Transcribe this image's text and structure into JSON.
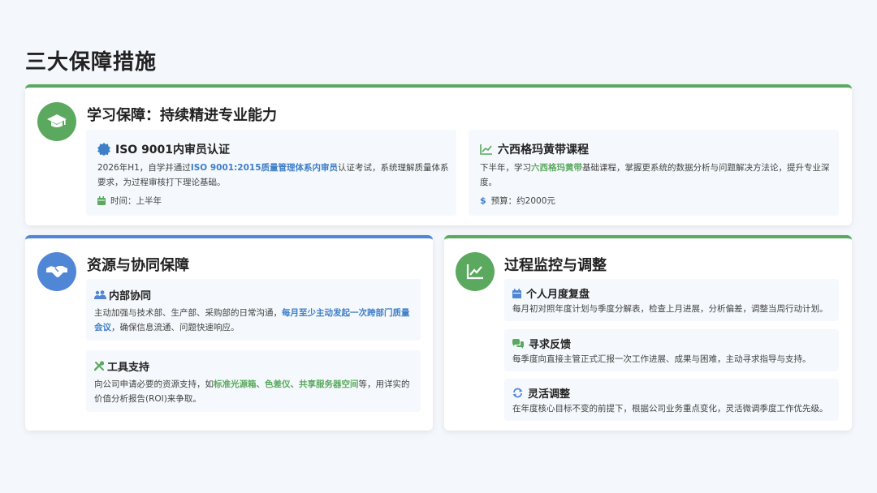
{
  "title": "三大保障措施",
  "colors": {
    "green": "#5aa95e",
    "blue": "#4f86d6",
    "highlight_blue": "#3f7fc8"
  },
  "learning": {
    "icon": "graduation-cap-icon",
    "title": "学习保障：持续精进专业能力",
    "iso": {
      "icon": "badge-icon",
      "title": "ISO 9001内审员认证",
      "text_before": "2026年H1，自学并通过",
      "highlight": "ISO 9001:2015质量管理体系内审员",
      "text_after": "认证考试，系统理解质量体系要求，为过程审核打下理论基础。",
      "meta_icon": "calendar-icon",
      "meta": "时间：上半年"
    },
    "sigma": {
      "icon": "line-chart-icon",
      "title": "六西格玛黄带课程",
      "text_before": "下半年，学习",
      "highlight": "六西格玛黄带",
      "text_after": "基础课程，掌握更系统的数据分析与问题解决方法论，提升专业深度。",
      "meta_icon": "dollar-icon",
      "meta": "预算：约2000元"
    }
  },
  "resource": {
    "icon": "handshake-icon",
    "title": "资源与协同保障",
    "internal": {
      "icon": "users-icon",
      "title": "内部协同",
      "text_before": "主动加强与技术部、生产部、采购部的日常沟通，",
      "highlight": "每月至少主动发起一次跨部门质量会议",
      "text_after": "，确保信息流通、问题快速响应。"
    },
    "tools": {
      "icon": "tools-icon",
      "title": "工具支持",
      "text_1": "向公司申请必要的资源支持，如",
      "hl_1": "标准光源箱",
      "sep_1": "、",
      "hl_2": "色差仪",
      "sep_2": "、",
      "hl_3": "共享服务器空间",
      "text_2": "等，用详实的价值分析报告(ROI)来争取。"
    }
  },
  "monitor": {
    "icon": "chart-icon",
    "title": "过程监控与调整",
    "items": [
      {
        "icon": "calendar-icon",
        "title": "个人月度复盘",
        "text": "每月初对照年度计划与季度分解表，检查上月进展，分析偏差，调整当周行动计划。"
      },
      {
        "icon": "comments-icon",
        "title": "寻求反馈",
        "text": "每季度向直接主管正式汇报一次工作进展、成果与困难，主动寻求指导与支持。"
      },
      {
        "icon": "sync-icon",
        "title": "灵活调整",
        "text": "在年度核心目标不变的前提下，根据公司业务重点变化，灵活微调季度工作优先级。"
      }
    ]
  }
}
